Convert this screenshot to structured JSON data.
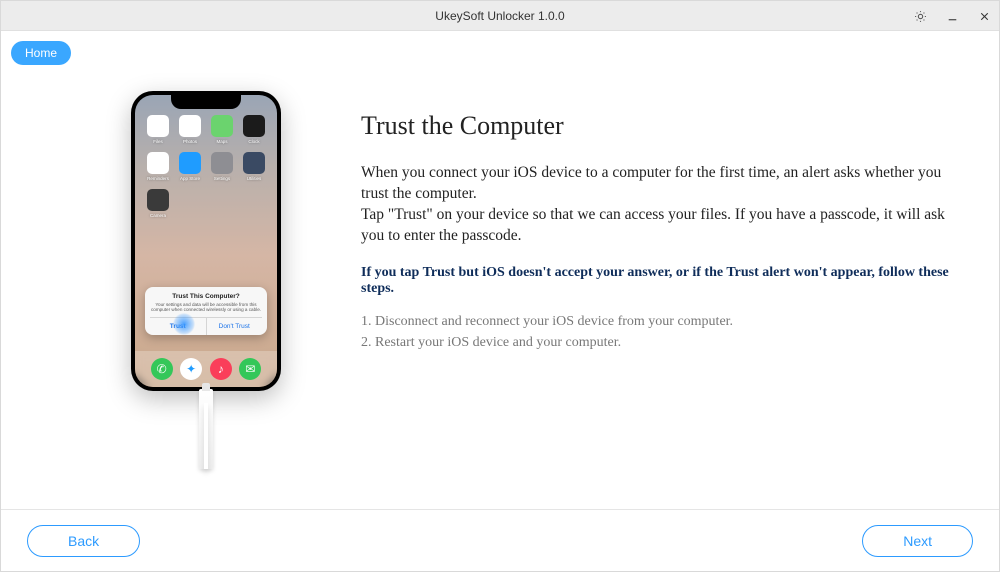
{
  "titlebar": {
    "title": "UkeySoft Unlocker 1.0.0"
  },
  "nav": {
    "home": "Home"
  },
  "phone": {
    "apps": [
      {
        "label": "Files",
        "color": "#ffffff"
      },
      {
        "label": "Photos",
        "color": "#ffffff"
      },
      {
        "label": "Maps",
        "color": "#6bd36e"
      },
      {
        "label": "Clock",
        "color": "#1b1b1b"
      },
      {
        "label": "Reminders",
        "color": "#ffffff"
      },
      {
        "label": "App Store",
        "color": "#1f9cff"
      },
      {
        "label": "Settings",
        "color": "#8e8e93"
      },
      {
        "label": "Utilities",
        "color": "#3a4a63"
      },
      {
        "label": "Camera",
        "color": "#3a3a3a"
      }
    ],
    "dock": [
      {
        "name": "phone-icon",
        "color": "#34c759",
        "glyph": "✆"
      },
      {
        "name": "safari-icon",
        "color": "#ffffff",
        "glyph": "✦"
      },
      {
        "name": "music-icon",
        "color": "#fa3e5a",
        "glyph": "♪"
      },
      {
        "name": "messages-icon",
        "color": "#34c759",
        "glyph": "✉"
      }
    ],
    "dialog": {
      "title": "Trust This Computer?",
      "message": "Your settings and data will be accessible from this computer when connected wirelessly or using a cable.",
      "trust": "Trust",
      "dont_trust": "Don't Trust"
    }
  },
  "main": {
    "heading": "Trust the Computer",
    "p1": "When you connect your iOS device to a computer for the first time, an alert asks whether you trust the computer.",
    "p2": "Tap \"Trust\" on your device so that we can access your files. If you have a passcode, it will ask you to enter the passcode.",
    "note": "If you tap Trust but iOS doesn't accept your answer, or if the Trust alert won't appear, follow these steps.",
    "step1": "1. Disconnect and reconnect your iOS device from your computer.",
    "step2": "2. Restart your iOS device and your computer."
  },
  "footer": {
    "back": "Back",
    "next": "Next"
  }
}
